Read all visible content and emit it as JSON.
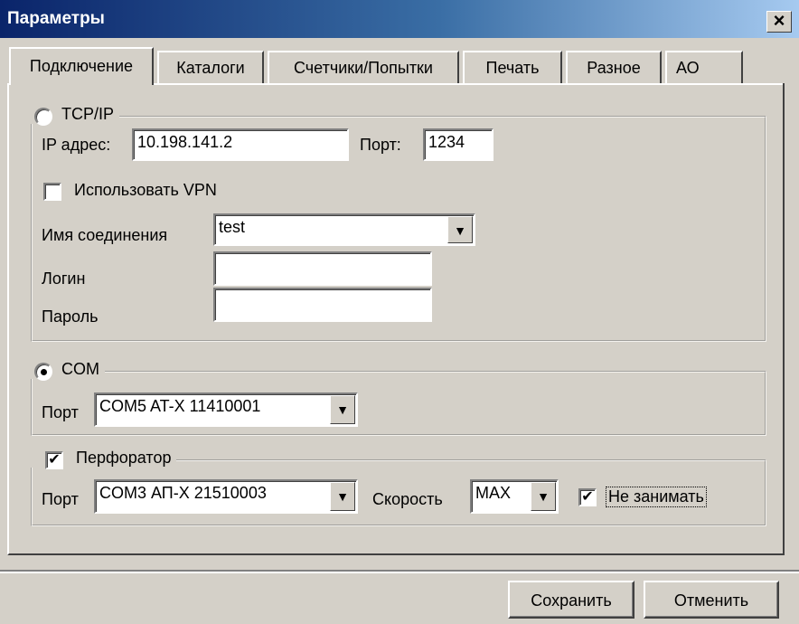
{
  "window": {
    "title": "Параметры",
    "close_glyph": "×"
  },
  "tabs": [
    {
      "label": "Подключение"
    },
    {
      "label": "Каталоги"
    },
    {
      "label": "Счетчики/Попытки"
    },
    {
      "label": "Печать"
    },
    {
      "label": "Разное"
    },
    {
      "label": "АО"
    }
  ],
  "tcpip": {
    "title": "TCP/IP",
    "ip_label": "IP адрес:",
    "ip_value": "10.198.141.2",
    "port_label": "Порт:",
    "port_value": "1234",
    "vpn_label": "Использовать VPN",
    "connection_label": "Имя соединения",
    "connection_value": "test",
    "login_label": "Логин",
    "login_value": "",
    "password_label": "Пароль",
    "password_value": ""
  },
  "com": {
    "title": "COM",
    "port_label": "Порт",
    "port_value": "COM5 AT-X 11410001"
  },
  "perforator": {
    "title": "Перфоратор",
    "port_label": "Порт",
    "port_value": "COM3 АП-Х 21510003",
    "speed_label": "Скорость",
    "speed_value": "MAX",
    "no_occupy_label": "Не занимать"
  },
  "buttons": {
    "save": "Сохранить",
    "cancel": "Отменить"
  },
  "icons": {
    "dropdown": "chevron-down-icon",
    "check": "check-icon",
    "close": "close-icon"
  },
  "colors": {
    "face": "#d4d0c8",
    "title_start": "#0a246a",
    "title_end": "#a6caf0"
  }
}
